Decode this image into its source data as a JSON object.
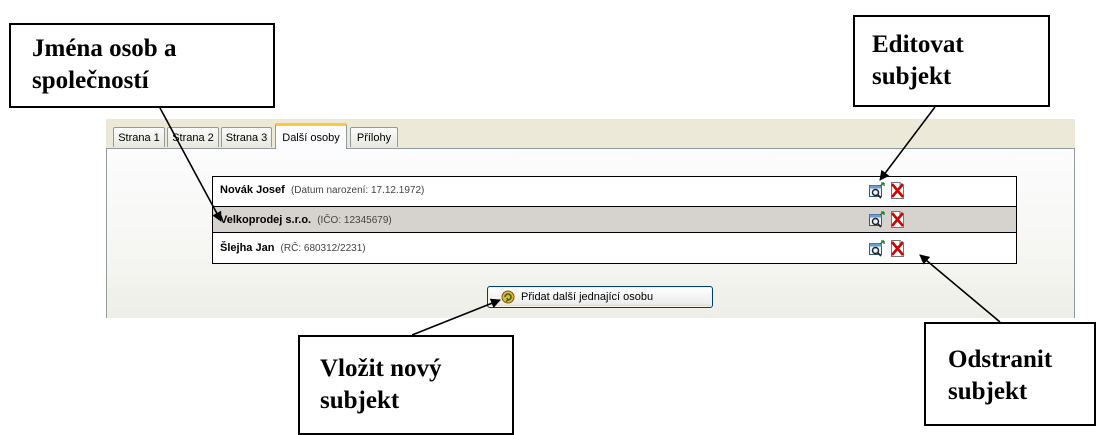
{
  "tabs": [
    {
      "label": "Strana 1",
      "active": false
    },
    {
      "label": "Strana 2",
      "active": false
    },
    {
      "label": "Strana 3",
      "active": false
    },
    {
      "label": "Další osoby",
      "active": true
    },
    {
      "label": "Přílohy",
      "active": false
    }
  ],
  "subjects": [
    {
      "name": "Novák Josef",
      "detail": "(Datum narození: 17.12.1972)",
      "selected": false
    },
    {
      "name": "Velkoprodej s.r.o.",
      "detail": "(IČO: 12345679)",
      "selected": true
    },
    {
      "name": "Šlejha Jan",
      "detail": "(RČ: 680312/2231)",
      "selected": false
    }
  ],
  "row_actions": {
    "edit_icon": "edit-subject-icon",
    "delete_icon": "delete-subject-icon"
  },
  "add_button": {
    "label": "Přidat další jednající osobu",
    "icon": "add-person-icon"
  },
  "callouts": {
    "names": [
      "Jména osob a",
      "společností"
    ],
    "edit": [
      "Editovat",
      "subjekt"
    ],
    "insert": [
      "Vložit nový",
      "subjekt"
    ],
    "remove": [
      "Odstranit",
      "subjekt"
    ]
  },
  "colors": {
    "active_tab_accent": "#ffc83c",
    "selected_row": "#d6d3ce",
    "delete_red": "#d40000"
  }
}
